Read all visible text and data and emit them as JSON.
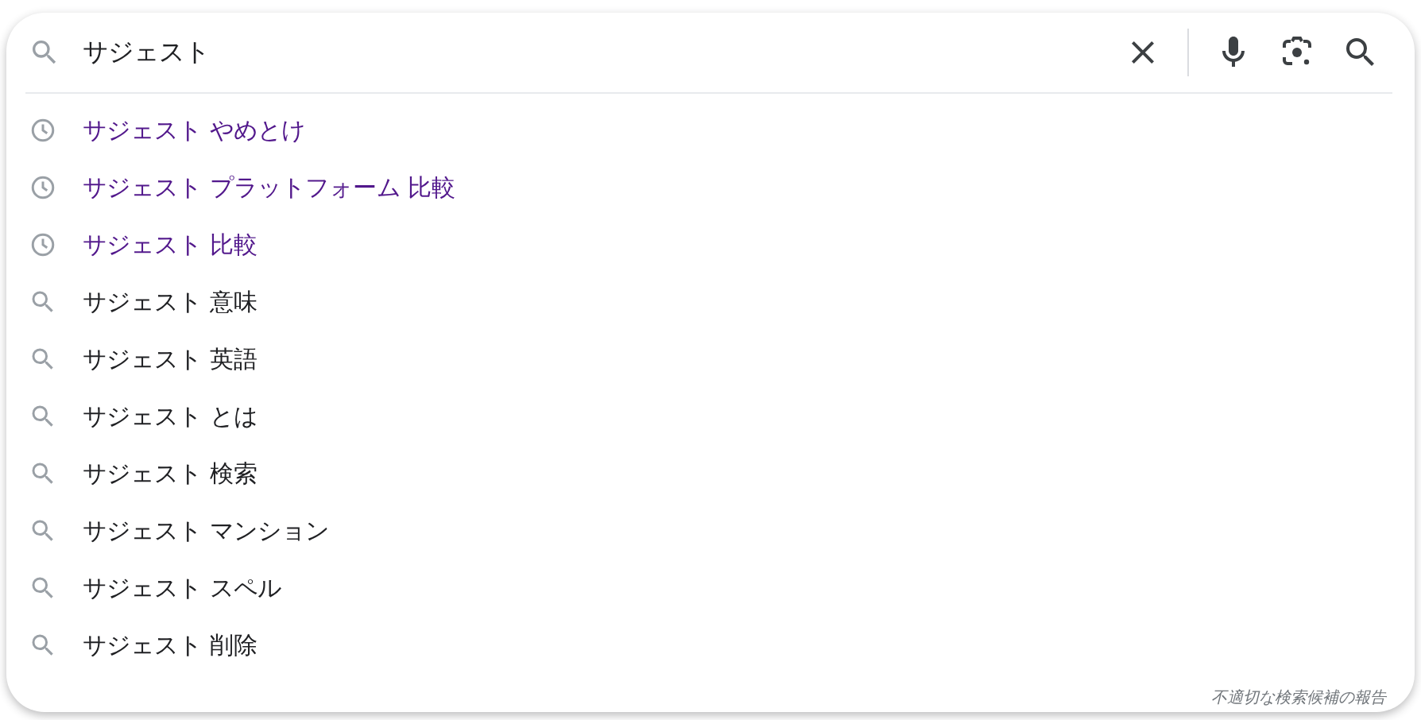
{
  "search": {
    "value": "サジェスト"
  },
  "suggestions": [
    {
      "kind": "history",
      "text": "サジェスト やめとけ"
    },
    {
      "kind": "history",
      "text": "サジェスト プラットフォーム 比較"
    },
    {
      "kind": "history",
      "text": "サジェスト 比較"
    },
    {
      "kind": "query",
      "text": "サジェスト 意味"
    },
    {
      "kind": "query",
      "text": "サジェスト 英語"
    },
    {
      "kind": "query",
      "text": "サジェスト とは"
    },
    {
      "kind": "query",
      "text": "サジェスト 検索"
    },
    {
      "kind": "query",
      "text": "サジェスト マンション"
    },
    {
      "kind": "query",
      "text": "サジェスト スペル"
    },
    {
      "kind": "query",
      "text": "サジェスト 削除"
    }
  ],
  "report_link": "不適切な検索候補の報告"
}
